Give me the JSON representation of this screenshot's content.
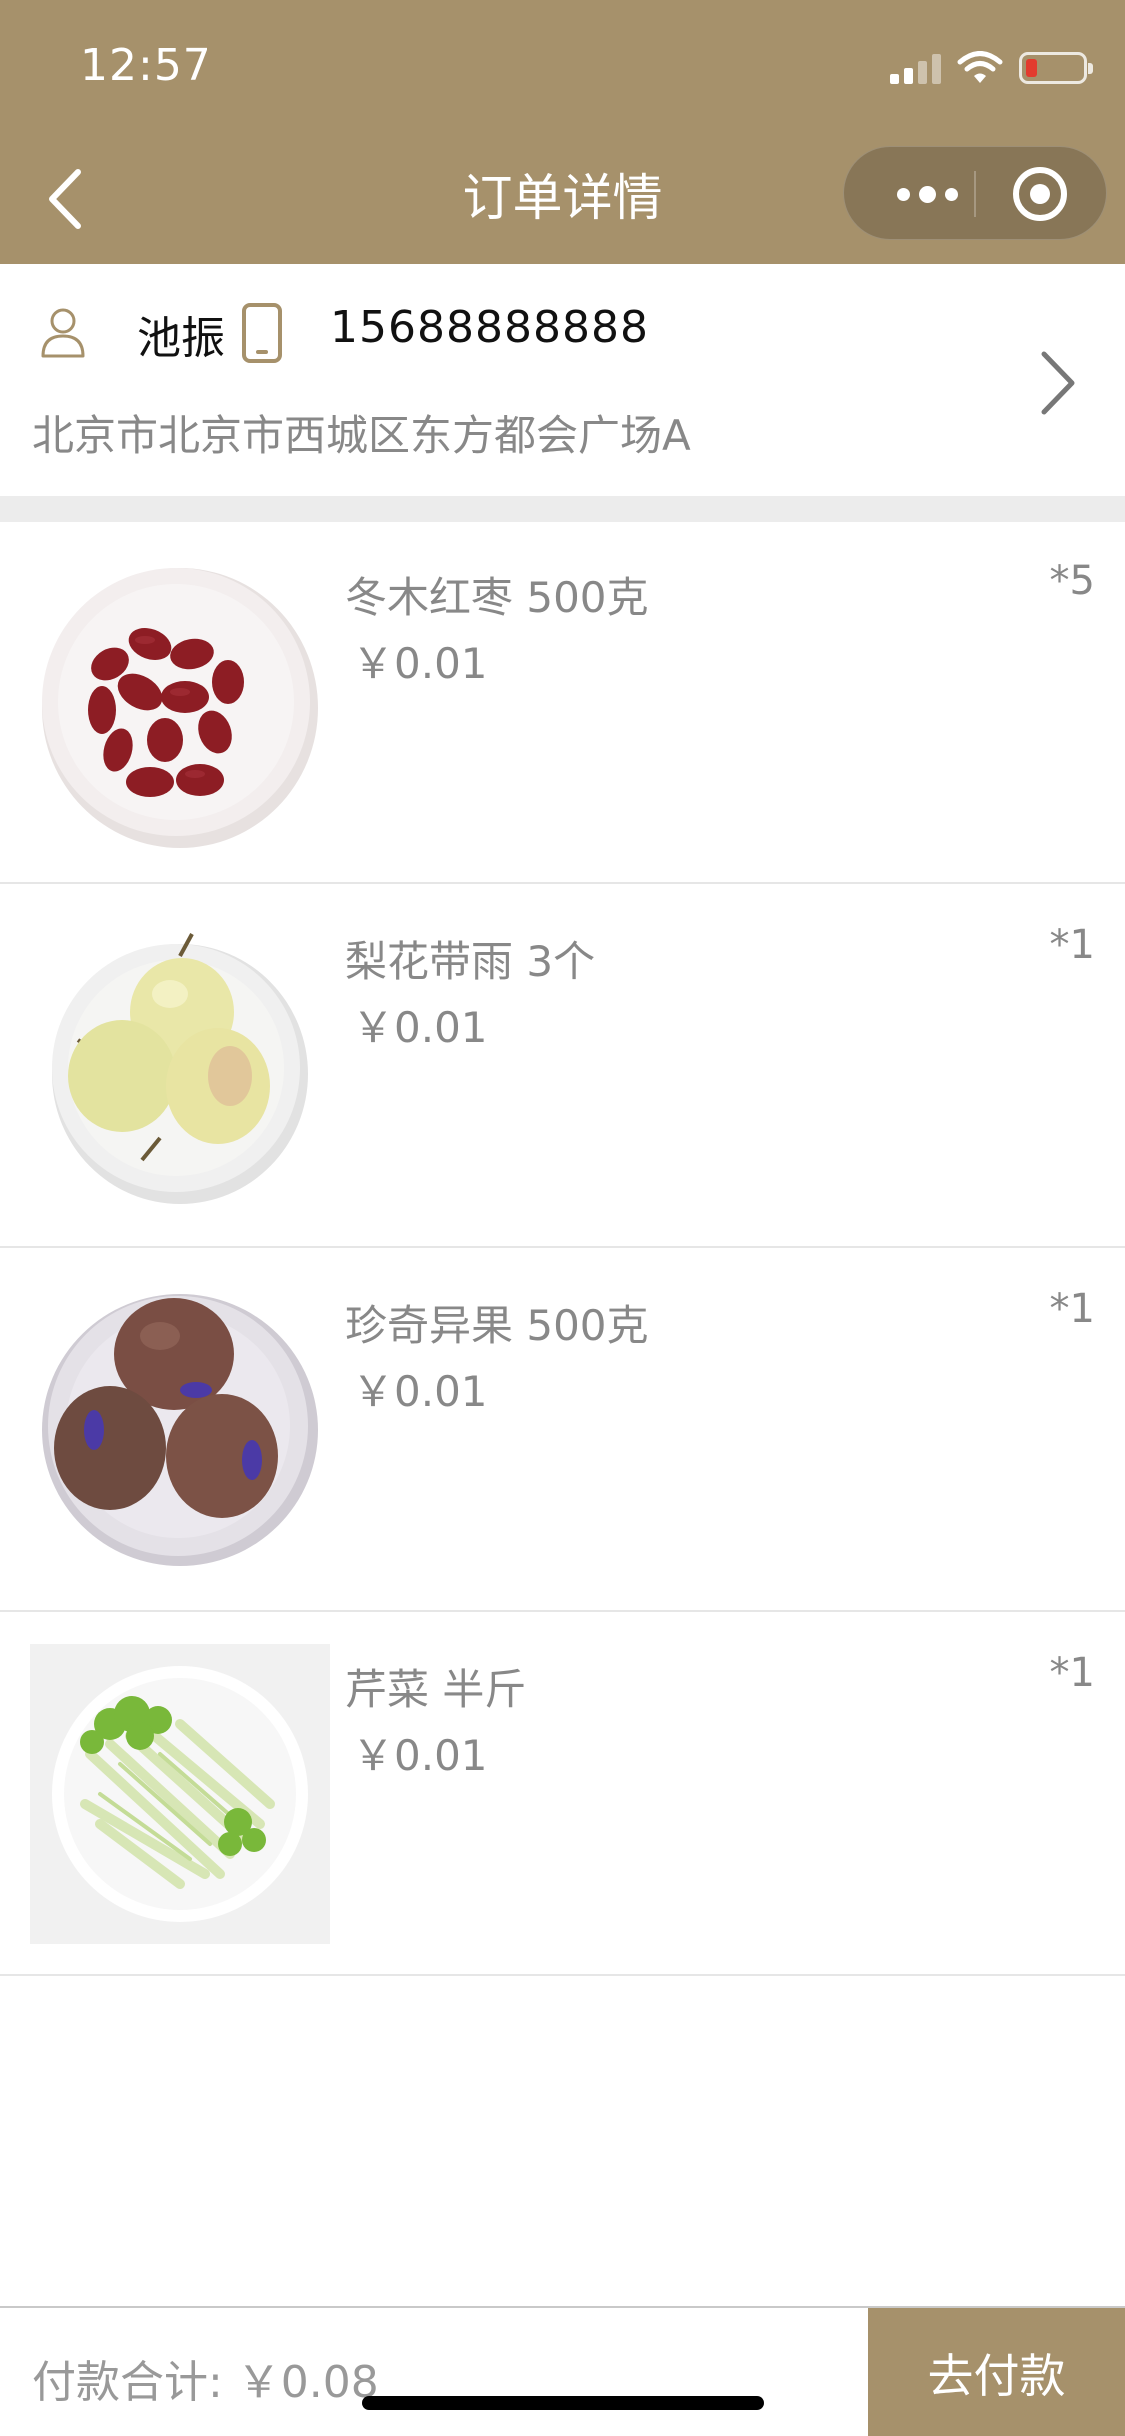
{
  "status_bar": {
    "time": "12:57"
  },
  "nav": {
    "title": "订单详情"
  },
  "address": {
    "name": "池振",
    "phone": "15688888888",
    "full_address": "北京市北京市西城区东方都会广场A"
  },
  "items": [
    {
      "name": "冬木红枣 500克",
      "price": "￥0.01",
      "qty": "*5",
      "image": "red-dates-photo"
    },
    {
      "name": "梨花带雨 3个",
      "price": "￥0.01",
      "qty": "*1",
      "image": "pears-photo"
    },
    {
      "name": "珍奇异果 500克",
      "price": "￥0.01",
      "qty": "*1",
      "image": "kiwi-photo"
    },
    {
      "name": "芹菜 半斤",
      "price": "￥0.01",
      "qty": "*1",
      "image": "celery-photo"
    }
  ],
  "footer": {
    "total_label": "付款合计: ￥0.08",
    "pay_label": "去付款"
  },
  "colors": {
    "brand": "#a6916b",
    "text_muted": "#888888"
  }
}
